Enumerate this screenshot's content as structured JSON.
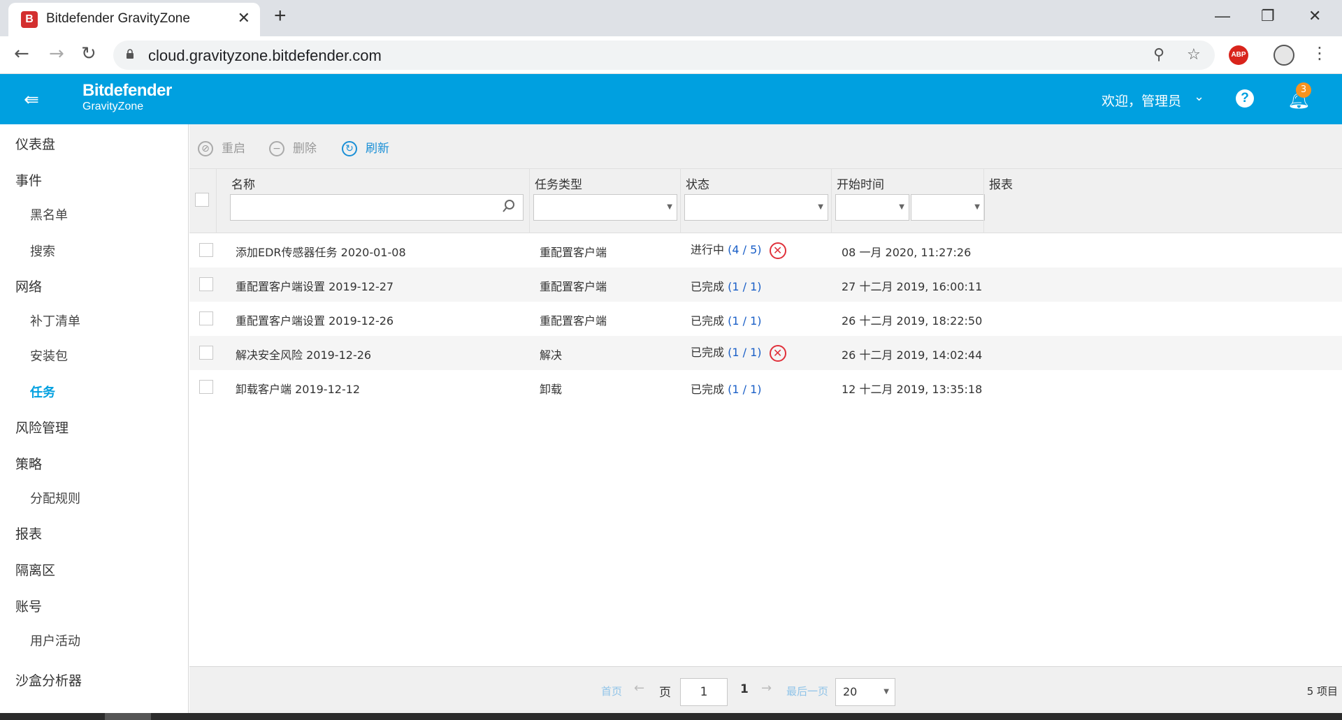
{
  "browser": {
    "tab_title": "Bitdefender GravityZone",
    "url": "cloud.gravityzone.bitdefender.com",
    "extension_abp": "ABP"
  },
  "header": {
    "brand_name": "Bitdefender",
    "brand_sub": "GravityZone",
    "welcome": "欢迎，管理员",
    "notification_count": "3",
    "help_glyph": "?"
  },
  "sidebar": {
    "items": [
      {
        "label": "仪表盘",
        "level": 0
      },
      {
        "label": "事件",
        "level": 0
      },
      {
        "label": "黑名单",
        "level": 1
      },
      {
        "label": "搜索",
        "level": 1
      },
      {
        "label": "网络",
        "level": 0
      },
      {
        "label": "补丁清单",
        "level": 1
      },
      {
        "label": "安装包",
        "level": 1
      },
      {
        "label": "任务",
        "level": 1,
        "active": true
      },
      {
        "label": "风险管理",
        "level": 0
      },
      {
        "label": "策略",
        "level": 0
      },
      {
        "label": "分配规则",
        "level": 1
      },
      {
        "label": "报表",
        "level": 0
      },
      {
        "label": "隔离区",
        "level": 0
      },
      {
        "label": "账号",
        "level": 0
      },
      {
        "label": "用户活动",
        "level": 1
      },
      {
        "label": "沙盒分析器",
        "level": 0
      }
    ]
  },
  "actions": {
    "restart": "重启",
    "delete": "删除",
    "refresh": "刷新"
  },
  "table": {
    "columns": [
      "名称",
      "任务类型",
      "状态",
      "开始时间",
      "报表"
    ],
    "rows": [
      {
        "name": "添加EDR传感器任务 2020-01-08",
        "type": "重配置客户端",
        "status": "进行中",
        "ratio": "(4 / 5)",
        "error": true,
        "time": "08 一月 2020, 11:27:26"
      },
      {
        "name": "重配置客户端设置 2019-12-27",
        "type": "重配置客户端",
        "status": "已完成",
        "ratio": "(1 / 1)",
        "error": false,
        "time": "27 十二月 2019, 16:00:11"
      },
      {
        "name": "重配置客户端设置 2019-12-26",
        "type": "重配置客户端",
        "status": "已完成",
        "ratio": "(1 / 1)",
        "error": false,
        "time": "26 十二月 2019, 18:22:50"
      },
      {
        "name": "解决安全风险 2019-12-26",
        "type": "解决",
        "status": "已完成",
        "ratio": "(1 / 1)",
        "error": true,
        "time": "26 十二月 2019, 14:02:44"
      },
      {
        "name": "卸载客户端 2019-12-12",
        "type": "卸载",
        "status": "已完成",
        "ratio": "(1 / 1)",
        "error": false,
        "time": "12 十二月 2019, 13:35:18"
      }
    ]
  },
  "pagination": {
    "first": "首页",
    "page_label": "页",
    "page_value": "1",
    "total_pages": "1",
    "last": "最后一页",
    "page_size": "20",
    "item_count": "5 项目"
  }
}
